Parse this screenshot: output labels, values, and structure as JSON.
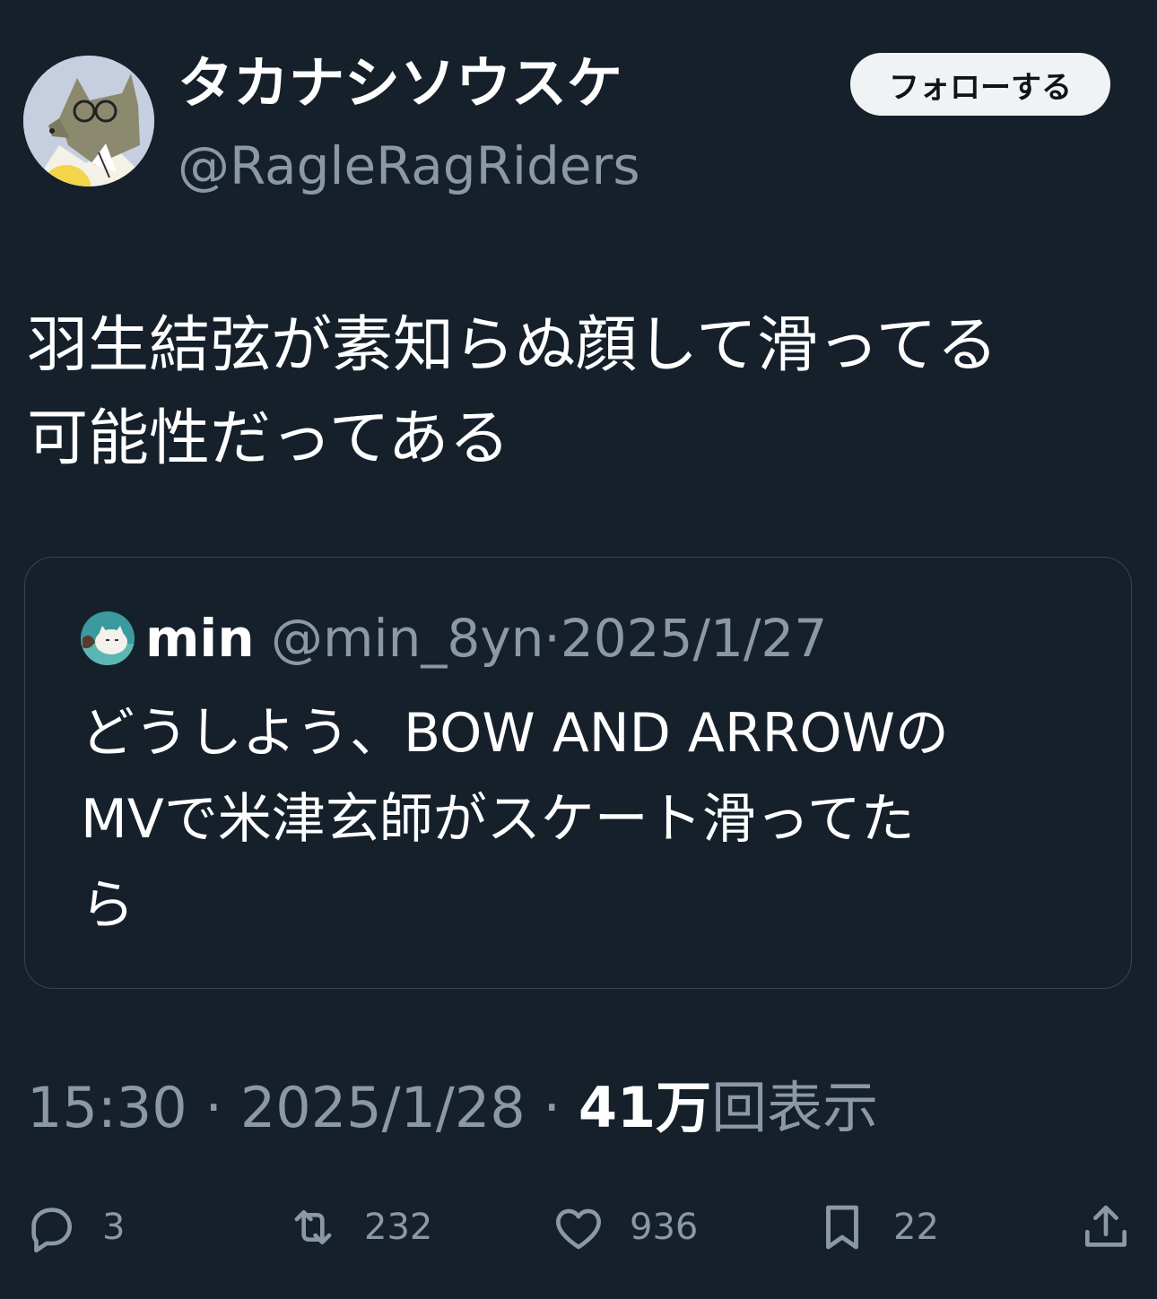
{
  "author": {
    "display_name": "タカナシソウスケ",
    "handle": "@RagleRagRiders",
    "avatar_icon": "wolf-avatar-icon"
  },
  "follow_button_label": "フォローする",
  "tweet": {
    "text": "羽生結弦が素知らぬ顔して滑ってる\n可能性だってある"
  },
  "quoted_tweet": {
    "name": "min",
    "handle": "@min_8yn",
    "separator": "·",
    "date": "2025/1/27",
    "text": "どうしよう、BOW AND ARROWの\nMVで米津玄師がスケート滑ってた\nら",
    "avatar_icon": "cat-avatar-icon"
  },
  "meta": {
    "time": "15:30",
    "sep1": " · ",
    "date": "2025/1/28",
    "sep2": " · ",
    "views_count": "41万",
    "views_label": "回表示"
  },
  "actions": {
    "reply_count": "3",
    "retweet_count": "232",
    "like_count": "936",
    "bookmark_count": "22"
  },
  "colors": {
    "background": "#15202b",
    "secondary_text": "#8b98a5",
    "border": "#38444d",
    "button_bg": "#eff3f4"
  }
}
